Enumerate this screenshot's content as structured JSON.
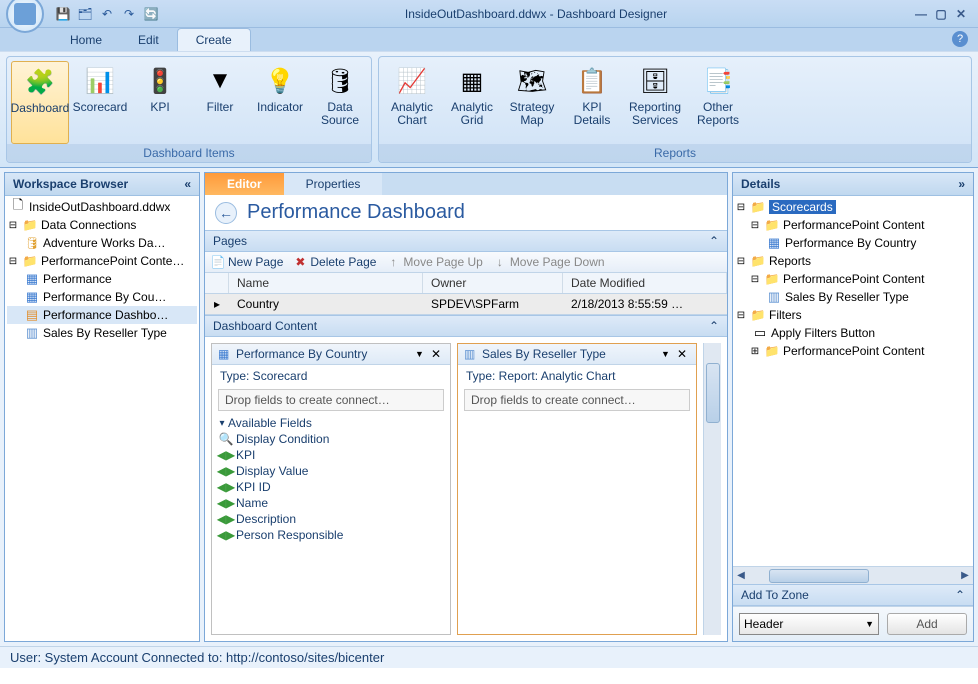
{
  "title": "InsideOutDashboard.ddwx - Dashboard Designer",
  "menu_tabs": {
    "home": "Home",
    "edit": "Edit",
    "create": "Create"
  },
  "ribbon": {
    "groups": {
      "dashboard_items": {
        "label": "Dashboard Items",
        "items": {
          "dashboard": "Dashboard",
          "scorecard": "Scorecard",
          "kpi": "KPI",
          "filter": "Filter",
          "indicator": "Indicator",
          "data_source": "Data\nSource"
        }
      },
      "reports": {
        "label": "Reports",
        "items": {
          "analytic_chart": "Analytic\nChart",
          "analytic_grid": "Analytic\nGrid",
          "strategy_map": "Strategy\nMap",
          "kpi_details": "KPI\nDetails",
          "reporting_services": "Reporting\nServices",
          "other_reports": "Other\nReports"
        }
      }
    }
  },
  "workspace": {
    "header": "Workspace Browser",
    "items": {
      "root": "InsideOutDashboard.ddwx",
      "data_connections": "Data Connections",
      "adventure_works": "Adventure Works Da…",
      "pp_content": "PerformancePoint Conte…",
      "performance": "Performance",
      "perf_by_country": "Performance By Cou…",
      "perf_dashboard": "Performance Dashbo…",
      "sales_by_reseller": "Sales By Reseller Type"
    }
  },
  "center": {
    "tabs": {
      "editor": "Editor",
      "properties": "Properties"
    },
    "dash_title": "Performance Dashboard",
    "pages": {
      "header": "Pages",
      "toolbar": {
        "new_page": "New Page",
        "delete_page": "Delete Page",
        "move_up": "Move Page Up",
        "move_down": "Move Page Down"
      },
      "columns": {
        "name": "Name",
        "owner": "Owner",
        "date": "Date Modified"
      },
      "rows": [
        {
          "name": "Country",
          "owner": "SPDEV\\SPFarm",
          "date": "2/18/2013 8:55:59 …"
        }
      ]
    },
    "content": {
      "header": "Dashboard Content",
      "zones": {
        "left": {
          "title": "Performance By Country",
          "type_label": "Type:  Scorecard",
          "drop": "Drop fields to create connect…",
          "fields_header": "Available Fields",
          "fields": [
            "Display Condition",
            "KPI",
            "Display Value",
            "KPI ID",
            "Name",
            "Description",
            "Person Responsible"
          ]
        },
        "right": {
          "title": "Sales By Reseller Type",
          "type_label": "Type:  Report: Analytic Chart",
          "drop": "Drop fields to create connect…"
        }
      }
    }
  },
  "details": {
    "header": "Details",
    "tree": {
      "scorecards": "Scorecards",
      "pp_content1": "PerformancePoint Content",
      "perf_by_country": "Performance By Country",
      "reports": "Reports",
      "pp_content2": "PerformancePoint Content",
      "sales_by_reseller": "Sales By Reseller Type",
      "filters": "Filters",
      "apply_filters": "Apply Filters Button",
      "pp_content3": "PerformancePoint Content"
    },
    "add_zone": {
      "header": "Add To Zone",
      "selected": "Header",
      "button": "Add"
    }
  },
  "status": "User: System Account  Connected to: http://contoso/sites/bicenter"
}
